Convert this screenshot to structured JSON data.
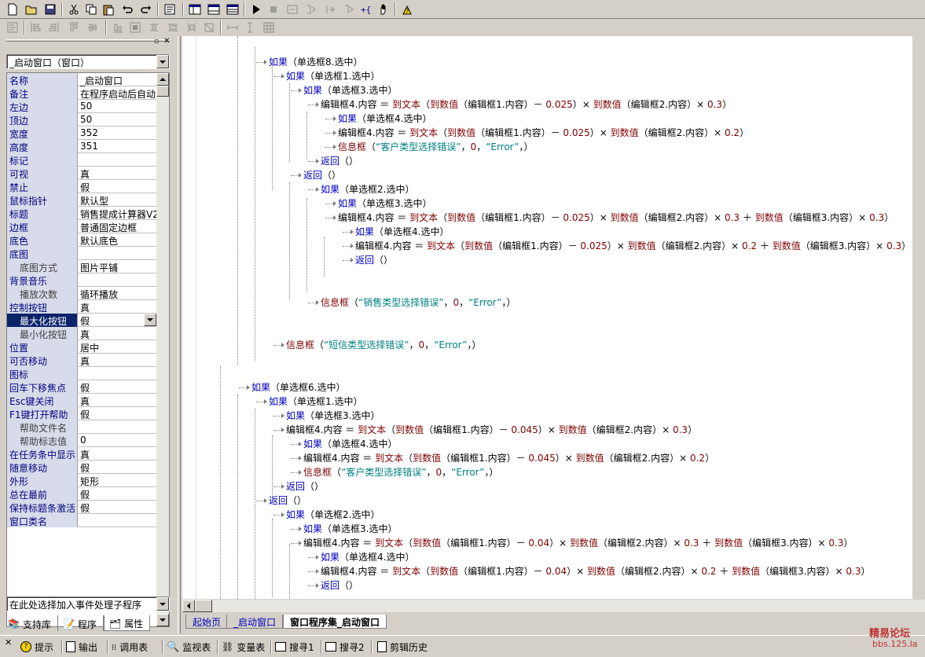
{
  "toolbar": {
    "row1_icons": [
      "new-file-icon",
      "open-folder-icon",
      "save-icon",
      "cut-icon",
      "copy-icon",
      "paste-icon",
      "undo-icon",
      "redo-icon",
      "find-icon",
      "layout1-icon",
      "layout2-icon",
      "layout3-icon",
      "run-icon",
      "stop-icon",
      "step-into-icon",
      "step-over-icon",
      "step-out-icon",
      "run-to-cursor-icon",
      "breakpoint-icon",
      "hand-icon",
      "help-icon"
    ],
    "row2_icons": [
      "align-left-icon",
      "align-center-h-icon",
      "align-right-icon",
      "align-top-icon",
      "align-center-v-icon",
      "align-bottom-icon",
      "center-h-icon",
      "center-v-icon",
      "same-width-icon",
      "same-height-icon",
      "same-size-icon",
      "space-h-icon",
      "space-v-icon",
      "grid-icon"
    ]
  },
  "left_panel": {
    "object_selector": "_启动窗口（窗口）",
    "properties": [
      {
        "name": "名称",
        "value": "_启动窗口",
        "indent": false
      },
      {
        "name": "备注",
        "value": "在程序启动后自动",
        "indent": false
      },
      {
        "name": "左边",
        "value": "50",
        "indent": false
      },
      {
        "name": "顶边",
        "value": "50",
        "indent": false
      },
      {
        "name": "宽度",
        "value": "352",
        "indent": false
      },
      {
        "name": "高度",
        "value": "351",
        "indent": false
      },
      {
        "name": "标记",
        "value": "",
        "indent": false
      },
      {
        "name": "可视",
        "value": "真",
        "indent": false
      },
      {
        "name": "禁止",
        "value": "假",
        "indent": false
      },
      {
        "name": "鼠标指针",
        "value": "默认型",
        "indent": false
      },
      {
        "name": "标题",
        "value": "销售提成计算器V2",
        "indent": false
      },
      {
        "name": "边框",
        "value": "普通固定边框",
        "indent": false
      },
      {
        "name": "底色",
        "value": "默认底色",
        "indent": false
      },
      {
        "name": "底图",
        "value": "",
        "indent": false
      },
      {
        "name": "底图方式",
        "value": "图片平铺",
        "indent": true
      },
      {
        "name": "背景音乐",
        "value": "",
        "indent": false
      },
      {
        "name": "播放次数",
        "value": "循环播放",
        "indent": true
      },
      {
        "name": "控制按钮",
        "value": "真",
        "indent": false
      },
      {
        "name": "最大化按钮",
        "value": "假",
        "indent": true,
        "selected": true
      },
      {
        "name": "最小化按钮",
        "value": "真",
        "indent": true
      },
      {
        "name": "位置",
        "value": "居中",
        "indent": false
      },
      {
        "name": "可否移动",
        "value": "真",
        "indent": false
      },
      {
        "name": "图标",
        "value": "",
        "indent": false
      },
      {
        "name": "回车下移焦点",
        "value": "假",
        "indent": false
      },
      {
        "name": "Esc键关闭",
        "value": "真",
        "indent": false
      },
      {
        "name": "F1键打开帮助",
        "value": "假",
        "indent": false
      },
      {
        "name": "帮助文件名",
        "value": "",
        "indent": true
      },
      {
        "name": "帮助标志值",
        "value": "0",
        "indent": true
      },
      {
        "name": "在任务条中显示",
        "value": "真",
        "indent": false
      },
      {
        "name": "随意移动",
        "value": "假",
        "indent": false
      },
      {
        "name": "外形",
        "value": "矩形",
        "indent": false
      },
      {
        "name": "总在最前",
        "value": "假",
        "indent": false
      },
      {
        "name": "保持标题条激活",
        "value": "假",
        "indent": false
      },
      {
        "name": "窗口类名",
        "value": "",
        "indent": false
      }
    ],
    "event_selector": "在此处选择加入事件处理子程序",
    "tabs": [
      "支持库",
      "程序",
      "属性"
    ]
  },
  "code_lines": [
    {
      "indent": 3,
      "parts": [
        [
          "kw",
          "如果"
        ],
        [
          "lbl",
          "（单选框8.选中）"
        ]
      ]
    },
    {
      "indent": 4,
      "parts": [
        [
          "kw",
          "如果"
        ],
        [
          "lbl",
          "（单选框1.选中）"
        ]
      ]
    },
    {
      "indent": 5,
      "parts": [
        [
          "kw",
          "如果"
        ],
        [
          "lbl",
          "（单选框3.选中）"
        ]
      ]
    },
    {
      "indent": 6,
      "parts": [
        [
          "lbl",
          "编辑框4.内容 ＝ "
        ],
        [
          "fn",
          "到文本"
        ],
        [
          "lbl",
          "（"
        ],
        [
          "fn",
          "到数值"
        ],
        [
          "lbl",
          "（编辑框1.内容）－ "
        ],
        [
          "num",
          "0.025"
        ],
        [
          "lbl",
          "）× "
        ],
        [
          "fn",
          "到数值"
        ],
        [
          "lbl",
          "（编辑框2.内容）× "
        ],
        [
          "num",
          "0.3"
        ],
        [
          "lbl",
          "）"
        ]
      ]
    },
    {
      "indent": 7,
      "parts": [
        [
          "kw",
          "如果"
        ],
        [
          "lbl",
          "（单选框4.选中）"
        ]
      ]
    },
    {
      "indent": 7,
      "parts": [
        [
          "lbl",
          "编辑框4.内容 ＝ "
        ],
        [
          "fn",
          "到文本"
        ],
        [
          "lbl",
          "（"
        ],
        [
          "fn",
          "到数值"
        ],
        [
          "lbl",
          "（编辑框1.内容）－ "
        ],
        [
          "num",
          "0.025"
        ],
        [
          "lbl",
          "）× "
        ],
        [
          "fn",
          "到数值"
        ],
        [
          "lbl",
          "（编辑框2.内容）× "
        ],
        [
          "num",
          "0.2"
        ],
        [
          "lbl",
          "）"
        ]
      ]
    },
    {
      "indent": 7,
      "parts": [
        [
          "fn",
          "信息框"
        ],
        [
          "lbl",
          "（"
        ],
        [
          "str",
          "“客户类型选择错误”"
        ],
        [
          "lbl",
          "，"
        ],
        [
          "num",
          "0"
        ],
        [
          "lbl",
          "，"
        ],
        [
          "str",
          "“Error”"
        ],
        [
          "lbl",
          "，）"
        ]
      ]
    },
    {
      "indent": 6,
      "parts": [
        [
          "kw",
          "返回"
        ],
        [
          "lbl",
          "（）"
        ]
      ]
    },
    {
      "indent": 5,
      "parts": [
        [
          "kw",
          "返回"
        ],
        [
          "lbl",
          "（）"
        ]
      ]
    },
    {
      "indent": 6,
      "parts": [
        [
          "kw",
          "如果"
        ],
        [
          "lbl",
          "（单选框2.选中）"
        ]
      ]
    },
    {
      "indent": 7,
      "parts": [
        [
          "kw",
          "如果"
        ],
        [
          "lbl",
          "（单选框3.选中）"
        ]
      ]
    },
    {
      "indent": 7,
      "parts": [
        [
          "lbl",
          "编辑框4.内容 ＝ "
        ],
        [
          "fn",
          "到文本"
        ],
        [
          "lbl",
          "（"
        ],
        [
          "fn",
          "到数值"
        ],
        [
          "lbl",
          "（编辑框1.内容）－ "
        ],
        [
          "num",
          "0.025"
        ],
        [
          "lbl",
          "）× "
        ],
        [
          "fn",
          "到数值"
        ],
        [
          "lbl",
          "（编辑框2.内容）× "
        ],
        [
          "num",
          "0.3"
        ],
        [
          "lbl",
          " ＋ "
        ],
        [
          "fn",
          "到数值"
        ],
        [
          "lbl",
          "（编辑框3.内容）× "
        ],
        [
          "num",
          "0.3"
        ],
        [
          "lbl",
          "）"
        ]
      ]
    },
    {
      "indent": 8,
      "parts": [
        [
          "kw",
          "如果"
        ],
        [
          "lbl",
          "（单选框4.选中）"
        ]
      ]
    },
    {
      "indent": 8,
      "parts": [
        [
          "lbl",
          "编辑框4.内容 ＝ "
        ],
        [
          "fn",
          "到文本"
        ],
        [
          "lbl",
          "（"
        ],
        [
          "fn",
          "到数值"
        ],
        [
          "lbl",
          "（编辑框1.内容）－ "
        ],
        [
          "num",
          "0.025"
        ],
        [
          "lbl",
          "）× "
        ],
        [
          "fn",
          "到数值"
        ],
        [
          "lbl",
          "（编辑框2.内容）× "
        ],
        [
          "num",
          "0.2"
        ],
        [
          "lbl",
          " ＋ "
        ],
        [
          "fn",
          "到数值"
        ],
        [
          "lbl",
          "（编辑框3.内容）× "
        ],
        [
          "num",
          "0.3"
        ],
        [
          "lbl",
          "）"
        ]
      ]
    },
    {
      "indent": 8,
      "parts": [
        [
          "kw",
          "返回"
        ],
        [
          "lbl",
          "（）"
        ]
      ]
    },
    {
      "indent": 6,
      "parts": [
        [
          "fn",
          "信息框"
        ],
        [
          "lbl",
          "（"
        ],
        [
          "str",
          "“销售类型选择错误”"
        ],
        [
          "lbl",
          "，"
        ],
        [
          "num",
          "0"
        ],
        [
          "lbl",
          "，"
        ],
        [
          "str",
          "“Error”"
        ],
        [
          "lbl",
          "，）"
        ]
      ]
    },
    {
      "indent": 4,
      "parts": [
        [
          "fn",
          "信息框"
        ],
        [
          "lbl",
          "（"
        ],
        [
          "str",
          "“短信类型选择错误”"
        ],
        [
          "lbl",
          "，"
        ],
        [
          "num",
          "0"
        ],
        [
          "lbl",
          "，"
        ],
        [
          "str",
          "“Error”"
        ],
        [
          "lbl",
          "，）"
        ]
      ]
    },
    {
      "indent": 2,
      "parts": [
        [
          "kw",
          "如果"
        ],
        [
          "lbl",
          "（单选框6.选中）"
        ]
      ]
    },
    {
      "indent": 3,
      "parts": [
        [
          "kw",
          "如果"
        ],
        [
          "lbl",
          "（单选框1.选中）"
        ]
      ]
    },
    {
      "indent": 4,
      "parts": [
        [
          "kw",
          "如果"
        ],
        [
          "lbl",
          "（单选框3.选中）"
        ]
      ]
    },
    {
      "indent": 4,
      "parts": [
        [
          "lbl",
          "编辑框4.内容 ＝ "
        ],
        [
          "fn",
          "到文本"
        ],
        [
          "lbl",
          "（"
        ],
        [
          "fn",
          "到数值"
        ],
        [
          "lbl",
          "（编辑框1.内容）－ "
        ],
        [
          "num",
          "0.045"
        ],
        [
          "lbl",
          "）× "
        ],
        [
          "fn",
          "到数值"
        ],
        [
          "lbl",
          "（编辑框2.内容）× "
        ],
        [
          "num",
          "0.3"
        ],
        [
          "lbl",
          "）"
        ]
      ]
    },
    {
      "indent": 5,
      "parts": [
        [
          "kw",
          "如果"
        ],
        [
          "lbl",
          "（单选框4.选中）"
        ]
      ]
    },
    {
      "indent": 5,
      "parts": [
        [
          "lbl",
          "编辑框4.内容 ＝ "
        ],
        [
          "fn",
          "到文本"
        ],
        [
          "lbl",
          "（"
        ],
        [
          "fn",
          "到数值"
        ],
        [
          "lbl",
          "（编辑框1.内容）－ "
        ],
        [
          "num",
          "0.045"
        ],
        [
          "lbl",
          "）× "
        ],
        [
          "fn",
          "到数值"
        ],
        [
          "lbl",
          "（编辑框2.内容）× "
        ],
        [
          "num",
          "0.2"
        ],
        [
          "lbl",
          "）"
        ]
      ]
    },
    {
      "indent": 5,
      "parts": [
        [
          "fn",
          "信息框"
        ],
        [
          "lbl",
          "（"
        ],
        [
          "str",
          "“客户类型选择错误”"
        ],
        [
          "lbl",
          "，"
        ],
        [
          "num",
          "0"
        ],
        [
          "lbl",
          "，"
        ],
        [
          "str",
          "“Error”"
        ],
        [
          "lbl",
          "，）"
        ]
      ]
    },
    {
      "indent": 4,
      "parts": [
        [
          "kw",
          "返回"
        ],
        [
          "lbl",
          "（）"
        ]
      ]
    },
    {
      "indent": 3,
      "parts": [
        [
          "kw",
          "返回"
        ],
        [
          "lbl",
          "（）"
        ]
      ]
    },
    {
      "indent": 4,
      "parts": [
        [
          "kw",
          "如果"
        ],
        [
          "lbl",
          "（单选框2.选中）"
        ]
      ]
    },
    {
      "indent": 5,
      "parts": [
        [
          "kw",
          "如果"
        ],
        [
          "lbl",
          "（单选框3.选中）"
        ]
      ]
    },
    {
      "indent": 5,
      "parts": [
        [
          "lbl",
          "编辑框4.内容 ＝ "
        ],
        [
          "fn",
          "到文本"
        ],
        [
          "lbl",
          "（"
        ],
        [
          "fn",
          "到数值"
        ],
        [
          "lbl",
          "（编辑框1.内容）－ "
        ],
        [
          "num",
          "0.04"
        ],
        [
          "lbl",
          "）× "
        ],
        [
          "fn",
          "到数值"
        ],
        [
          "lbl",
          "（编辑框2.内容）× "
        ],
        [
          "num",
          "0.3"
        ],
        [
          "lbl",
          " ＋ "
        ],
        [
          "fn",
          "到数值"
        ],
        [
          "lbl",
          "（编辑框3.内容）× "
        ],
        [
          "num",
          "0.3"
        ],
        [
          "lbl",
          "）"
        ]
      ]
    },
    {
      "indent": 6,
      "parts": [
        [
          "kw",
          "如果"
        ],
        [
          "lbl",
          "（单选框4.选中）"
        ]
      ]
    },
    {
      "indent": 6,
      "parts": [
        [
          "lbl",
          "编辑框4.内容 ＝ "
        ],
        [
          "fn",
          "到文本"
        ],
        [
          "lbl",
          "（"
        ],
        [
          "fn",
          "到数值"
        ],
        [
          "lbl",
          "（编辑框1.内容）－ "
        ],
        [
          "num",
          "0.04"
        ],
        [
          "lbl",
          "）× "
        ],
        [
          "fn",
          "到数值"
        ],
        [
          "lbl",
          "（编辑框2.内容）× "
        ],
        [
          "num",
          "0.2"
        ],
        [
          "lbl",
          " ＋ "
        ],
        [
          "fn",
          "到数值"
        ],
        [
          "lbl",
          "（编辑框3.内容）× "
        ],
        [
          "num",
          "0.3"
        ],
        [
          "lbl",
          "）"
        ]
      ]
    },
    {
      "indent": 6,
      "parts": [
        [
          "kw",
          "返回"
        ],
        [
          "lbl",
          "（）"
        ]
      ]
    }
  ],
  "code_tabs": [
    "起始页",
    "_启动窗口",
    "窗口程序集_启动窗口"
  ],
  "bottom_bar": {
    "buttons": [
      {
        "label": "提示",
        "icon": "hint-icon"
      },
      {
        "label": "输出",
        "icon": "output-icon"
      },
      {
        "label": "调用表",
        "icon": "call-stack-icon"
      },
      {
        "label": "监视表",
        "icon": "watch-icon"
      },
      {
        "label": "变量表",
        "icon": "variables-icon"
      },
      {
        "label": "搜寻1",
        "icon": "search1-icon"
      },
      {
        "label": "搜寻2",
        "icon": "search2-icon"
      },
      {
        "label": "剪辑历史",
        "icon": "clip-history-icon"
      }
    ],
    "watermark_title": "精易论坛",
    "watermark_url": "bbs.125.la"
  }
}
